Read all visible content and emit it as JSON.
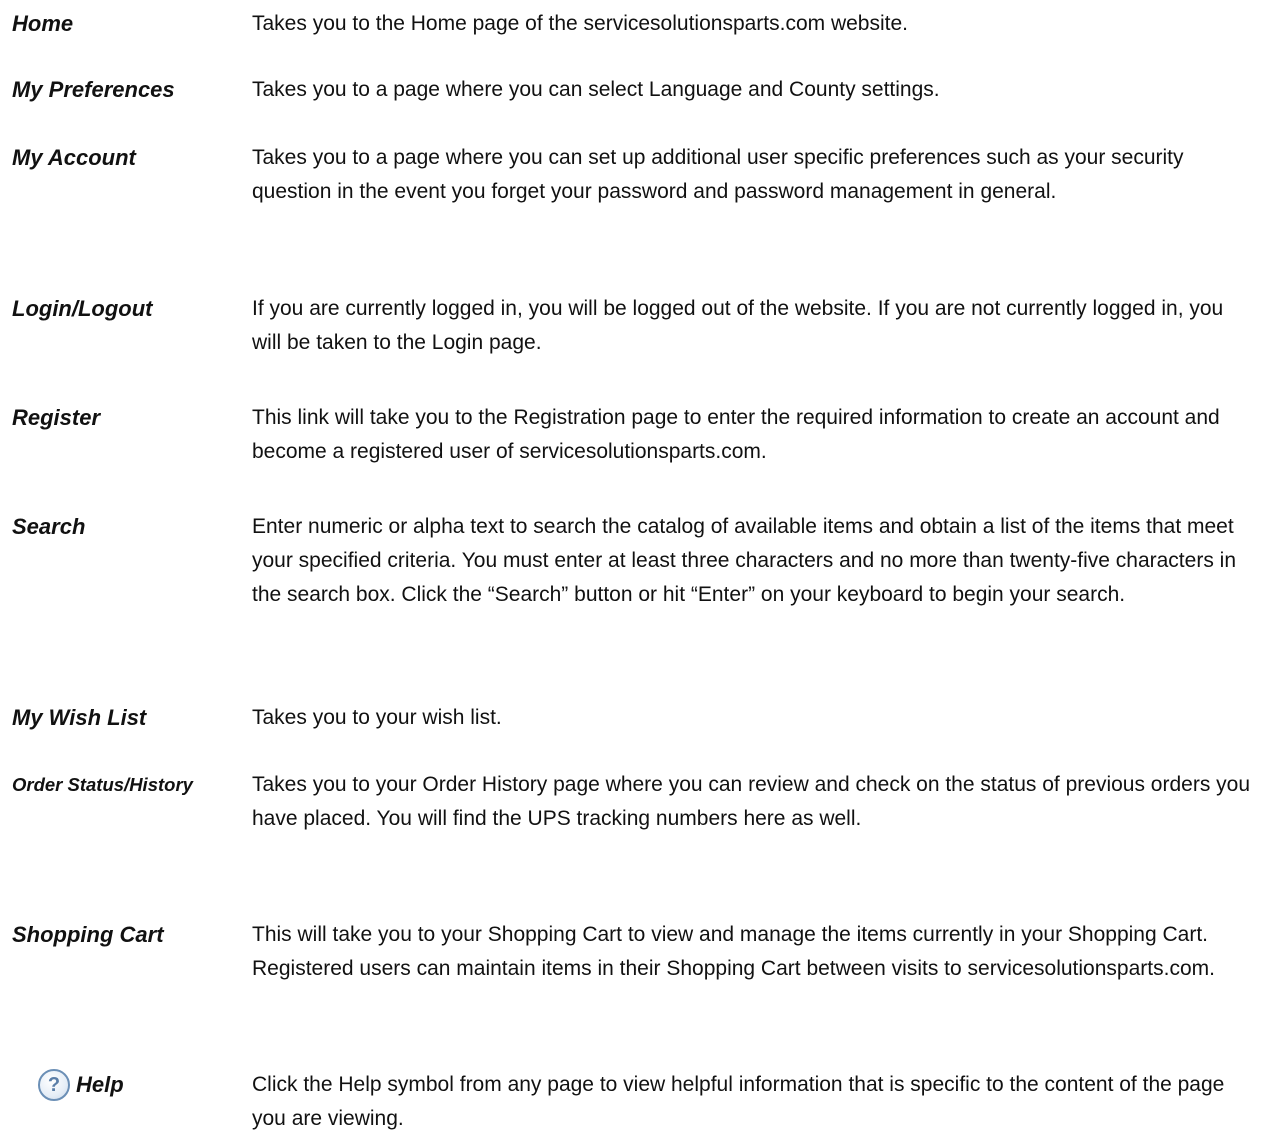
{
  "entries": [
    {
      "term": "Home",
      "description": "Takes you to the Home page of the servicesolutionsparts.com website."
    },
    {
      "term": "My Preferences",
      "description": "Takes you to a page where you can select Language and County settings."
    },
    {
      "term": "My Account",
      "description": "Takes you to a page where you can set up additional user specific preferences such as your security question in the event you forget your password and password management in general."
    },
    {
      "term": "Login/Logout",
      "description": "If you are currently logged in, you will be logged out of the website. If you are not currently logged in, you will be taken to the Login page."
    },
    {
      "term": "Register",
      "description": "This link will take you to the Registration page to enter the required information to create an account and become a registered user of servicesolutionsparts.com."
    },
    {
      "term": "Search",
      "description": "Enter numeric or alpha text to search the catalog of available items and obtain a list of the items that meet your specified criteria. You must enter at least three characters and no more than twenty-five characters in the search box. Click the “Search” button or hit “Enter” on your keyboard to begin your search."
    },
    {
      "term": "My Wish List",
      "description": "Takes you to your wish list."
    },
    {
      "term": "Order Status/History",
      "description": "Takes you to your Order History page where you can review and check on the status of previous orders you have placed.  You will find the UPS tracking numbers here as well."
    },
    {
      "term": "Shopping Cart",
      "description": "This will take you to your Shopping Cart to view and manage the items currently in your Shopping Cart. Registered users can maintain items in their Shopping Cart between visits to servicesolutionsparts.com."
    },
    {
      "term": "Help",
      "description": "Click the Help symbol from any page to view helpful information that is specific to the content of the page you are viewing.",
      "icon": "help-question-icon",
      "icon_glyph": "?"
    }
  ]
}
